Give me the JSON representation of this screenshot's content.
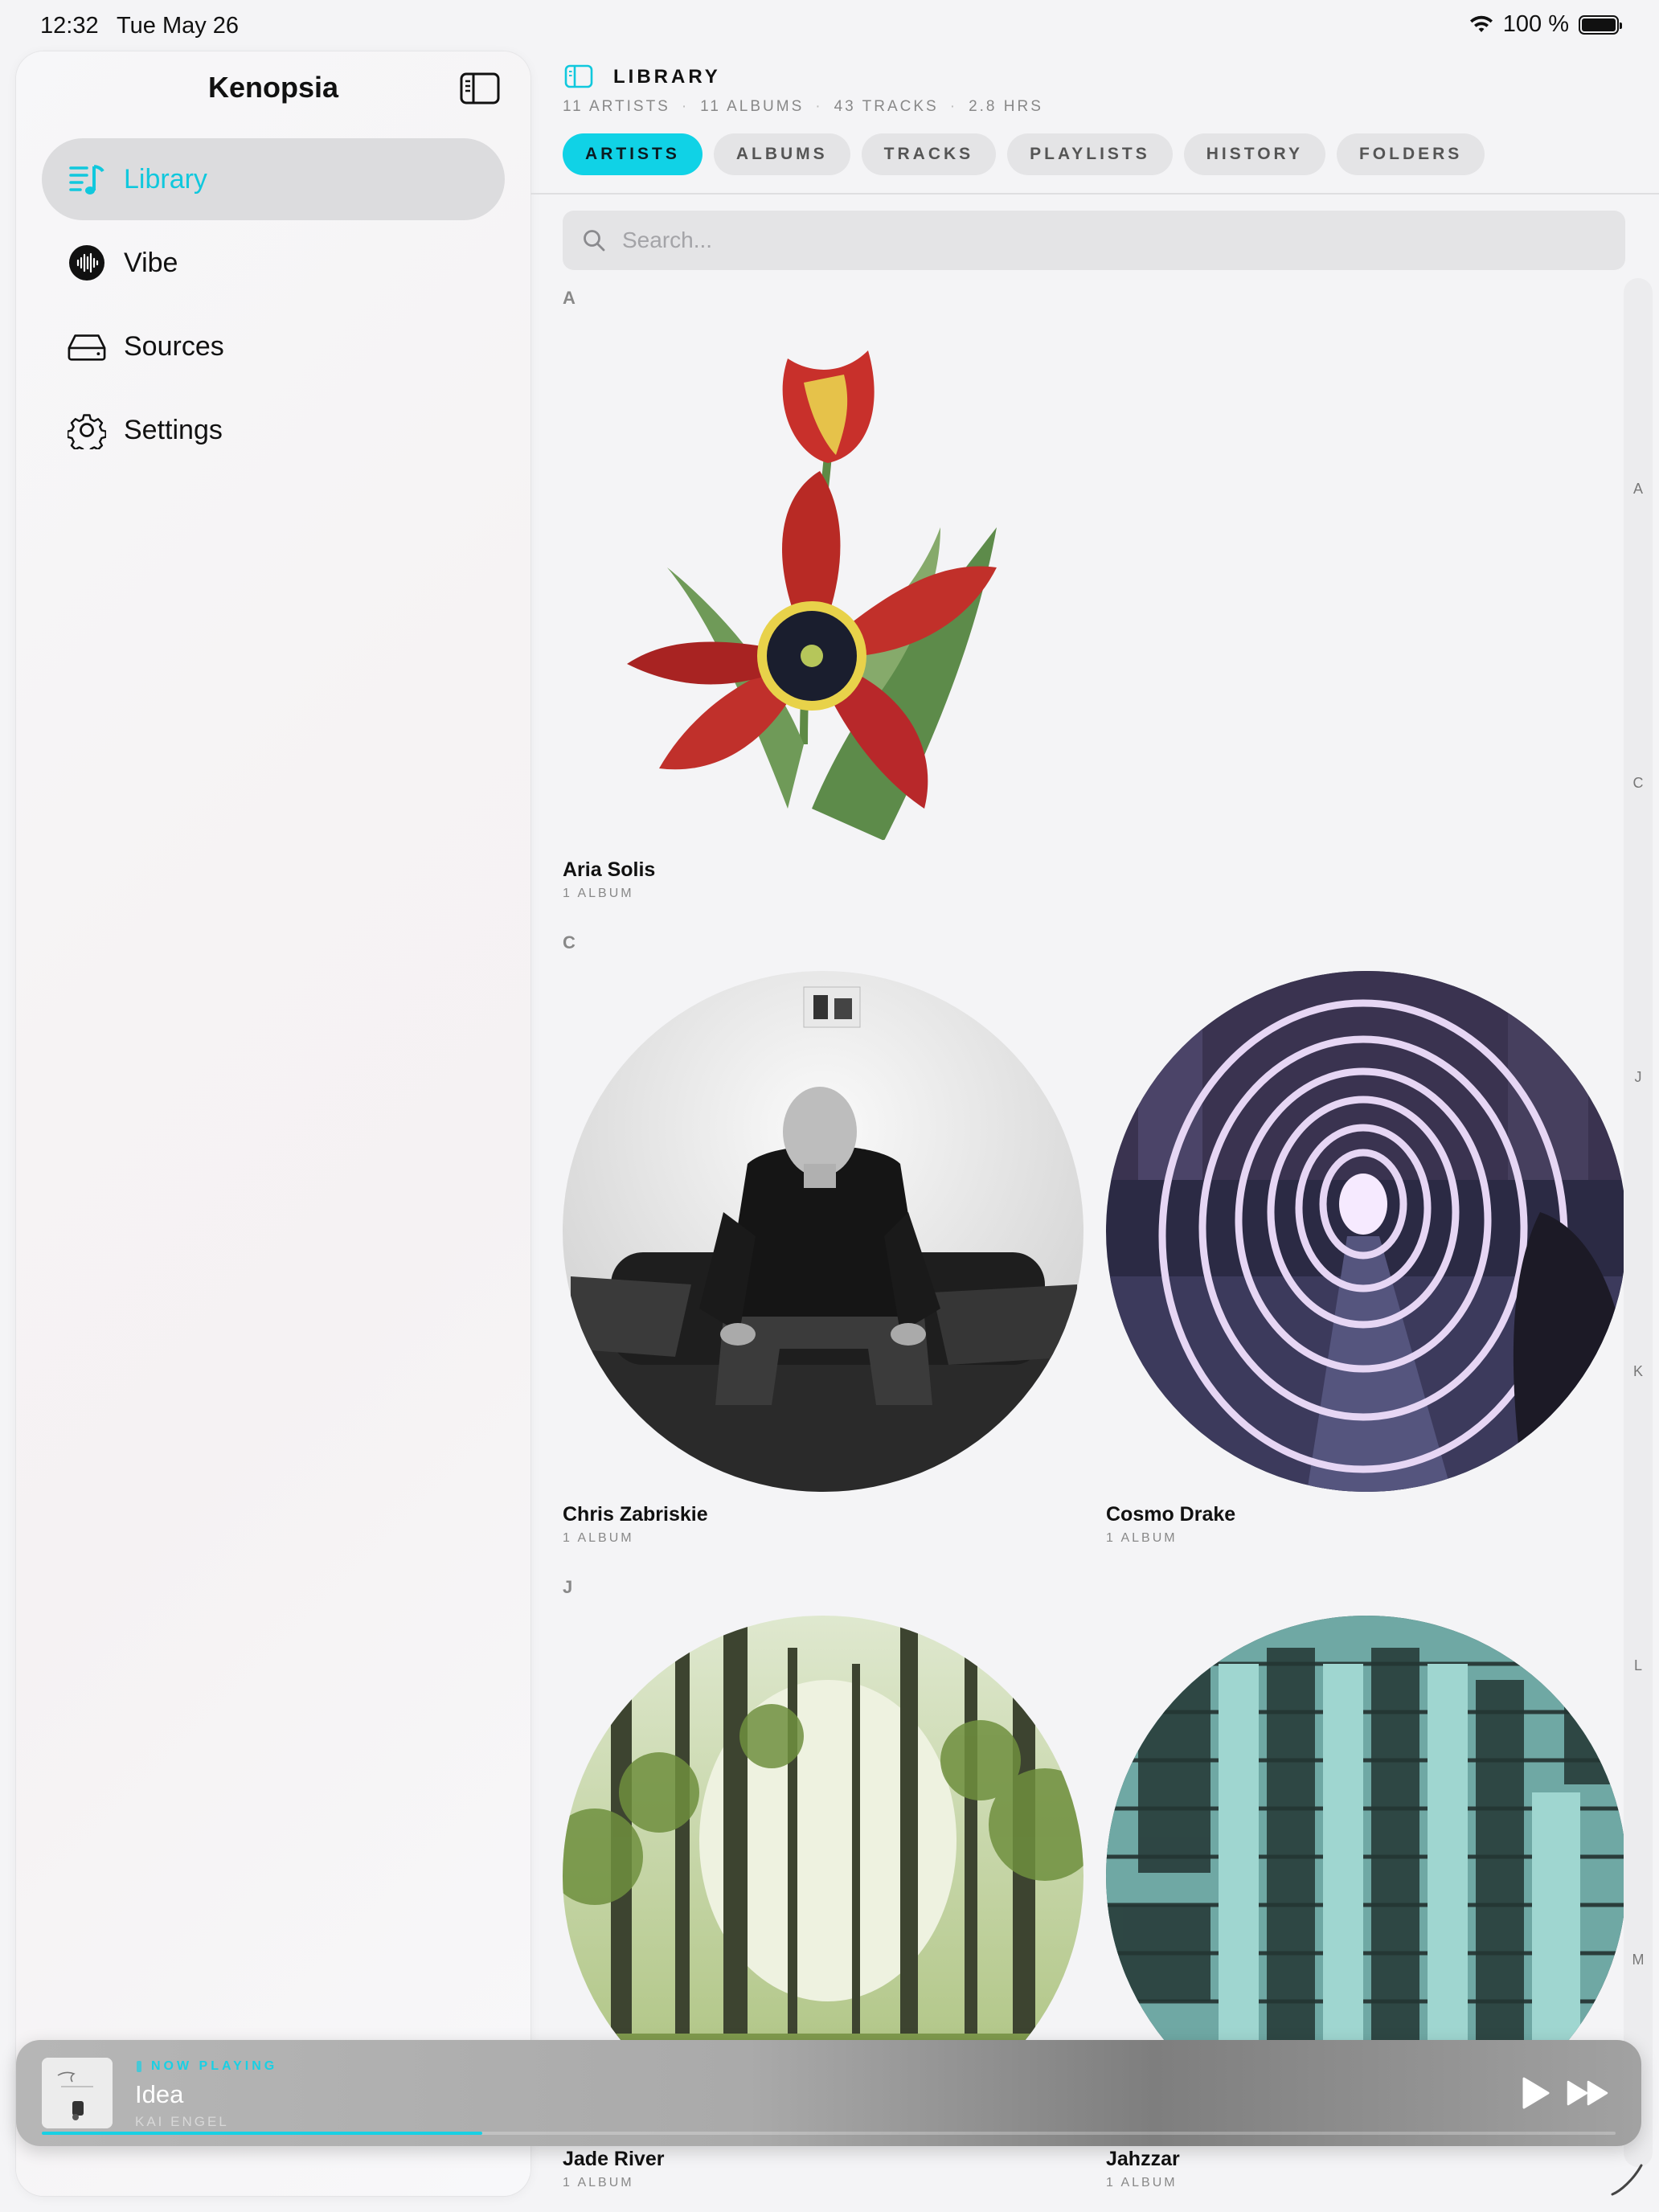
{
  "status_bar": {
    "time": "12:32",
    "date": "Tue May 26",
    "battery": "100 %"
  },
  "sidebar": {
    "title": "Kenopsia",
    "items": [
      {
        "label": "Library",
        "icon": "music-list-icon",
        "active": true
      },
      {
        "label": "Vibe",
        "icon": "waveform-icon",
        "active": false
      },
      {
        "label": "Sources",
        "icon": "drive-icon",
        "active": false
      },
      {
        "label": "Settings",
        "icon": "gear-icon",
        "active": false
      }
    ]
  },
  "header": {
    "title": "LIBRARY",
    "stats": [
      "11 ARTISTS",
      "11 ALBUMS",
      "43 TRACKS",
      "2.8 HRS"
    ]
  },
  "tabs": [
    {
      "label": "ARTISTS",
      "active": true
    },
    {
      "label": "ALBUMS",
      "active": false
    },
    {
      "label": "TRACKS",
      "active": false
    },
    {
      "label": "PLAYLISTS",
      "active": false
    },
    {
      "label": "HISTORY",
      "active": false
    },
    {
      "label": "FOLDERS",
      "active": false
    }
  ],
  "search": {
    "placeholder": "Search..."
  },
  "sections": [
    {
      "letter": "A",
      "artists": [
        {
          "name": "Aria Solis",
          "sub": "1 ALBUM",
          "art": "tulip-illustration"
        }
      ]
    },
    {
      "letter": "C",
      "artists": [
        {
          "name": "Chris Zabriskie",
          "sub": "1 ALBUM",
          "art": "man-on-sofa-photo"
        },
        {
          "name": "Cosmo Drake",
          "sub": "1 ALBUM",
          "art": "light-tunnel-photo"
        }
      ]
    },
    {
      "letter": "J",
      "artists": [
        {
          "name": "Jade River",
          "sub": "1 ALBUM",
          "art": "forest-photo"
        },
        {
          "name": "Jahzzar",
          "sub": "1 ALBUM",
          "art": "graffiti-wall-photo"
        }
      ]
    }
  ],
  "index_letters": [
    "A",
    "C",
    "J",
    "K",
    "L",
    "M"
  ],
  "now_playing": {
    "label": "NOW PLAYING",
    "title": "Idea",
    "artist": "KAI ENGEL",
    "progress": 0.28
  },
  "colors": {
    "accent": "#10d2e6",
    "active_nav_bg": "#dcdcde"
  }
}
